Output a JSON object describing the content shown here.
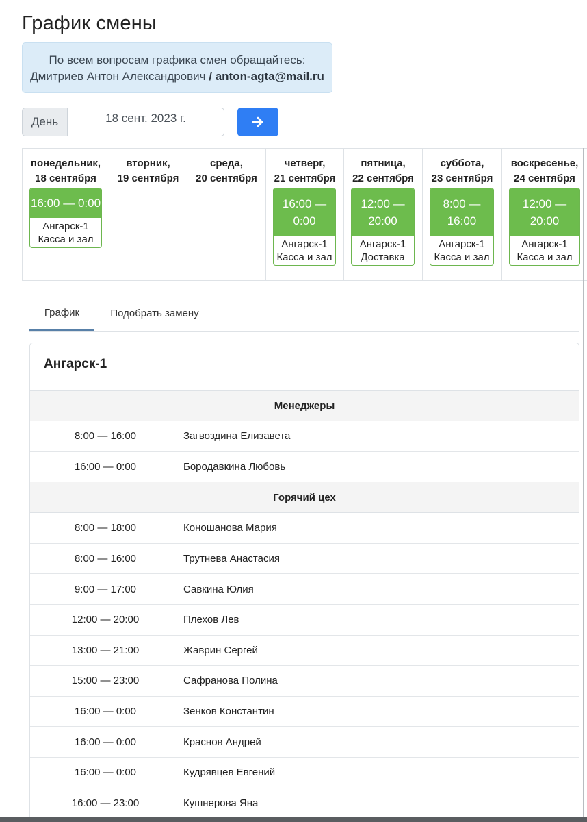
{
  "title": "График смены",
  "info": {
    "line1": "По всем вопросам графика смен обращайтесь:",
    "name": "Дмитриев Антон Александрович",
    "separator": " / ",
    "email": "anton-agta@mail.ru"
  },
  "date_filter": {
    "prefix": "День",
    "value": "18 сент. 2023 г.",
    "go_icon": "arrow-right-icon"
  },
  "colors": {
    "shift_green": "#6dbc4d",
    "button_blue": "#2f7ef4",
    "info_bg": "#dcecf8"
  },
  "week": [
    {
      "name": "понедельник,",
      "date": "18 сентября",
      "shift": {
        "time": "16:00 — 0:00",
        "place": "Ангарск-1",
        "role": "Касса и зал"
      }
    },
    {
      "name": "вторник,",
      "date": "19 сентября",
      "shift": null
    },
    {
      "name": "среда,",
      "date": "20 сентября",
      "shift": null
    },
    {
      "name": "четверг,",
      "date": "21 сентября",
      "shift": {
        "time_a": "16:00 —",
        "time_b": "0:00",
        "place": "Ангарск-1",
        "role": "Касса и зал"
      }
    },
    {
      "name": "пятница,",
      "date": "22 сентября",
      "shift": {
        "time_a": "12:00 —",
        "time_b": "20:00",
        "place": "Ангарск-1",
        "role": "Доставка"
      }
    },
    {
      "name": "суббота,",
      "date": "23 сентября",
      "shift": {
        "time_a": "8:00 —",
        "time_b": "16:00",
        "place": "Ангарск-1",
        "role": "Касса и зал"
      }
    },
    {
      "name": "воскресенье,",
      "date": "24 сентября",
      "shift": {
        "time_a": "12:00 —",
        "time_b": "20:00",
        "place": "Ангарск-1",
        "role": "Касса и зал"
      }
    }
  ],
  "tabs": [
    {
      "label": "График",
      "active": true
    },
    {
      "label": "Подобрать замену",
      "active": false
    }
  ],
  "location": "Ангарск-1",
  "groups": [
    {
      "title": "Менеджеры",
      "rows": [
        {
          "time": "8:00 — 16:00",
          "name": "Загвоздина Елизавета"
        },
        {
          "time": "16:00 — 0:00",
          "name": "Бородавкина Любовь"
        }
      ]
    },
    {
      "title": "Горячий цех",
      "rows": [
        {
          "time": "8:00 — 18:00",
          "name": "Коношанова Мария"
        },
        {
          "time": "8:00 — 16:00",
          "name": "Трутнева Анастасия"
        },
        {
          "time": "9:00 — 17:00",
          "name": "Савкина Юлия"
        },
        {
          "time": "12:00 — 20:00",
          "name": "Плехов Лев"
        },
        {
          "time": "13:00 — 21:00",
          "name": "Жаврин Сергей"
        },
        {
          "time": "15:00 — 23:00",
          "name": "Сафранова Полина"
        },
        {
          "time": "16:00 — 0:00",
          "name": "Зенков Константин"
        },
        {
          "time": "16:00 — 0:00",
          "name": "Краснов Андрей"
        },
        {
          "time": "16:00 — 0:00",
          "name": "Кудрявцев Евгений"
        },
        {
          "time": "16:00 — 23:00",
          "name": "Кушнерова Яна"
        }
      ]
    }
  ]
}
